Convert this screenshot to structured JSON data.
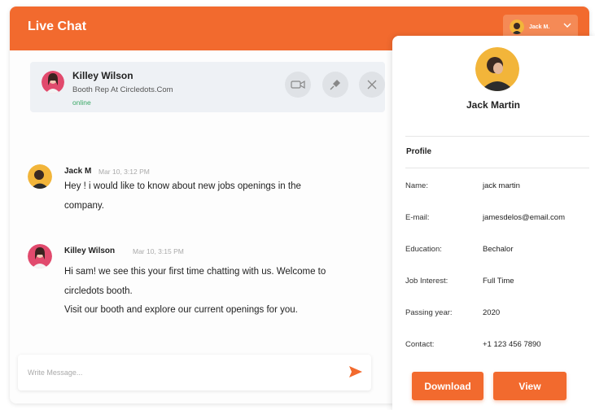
{
  "header": {
    "title": "Live Chat",
    "user_name": "Jack M."
  },
  "contact": {
    "name": "Killey Wilson",
    "role": "Booth Rep At Circledots.Com",
    "status": "online"
  },
  "messages": [
    {
      "sender": "Jack M",
      "time": "Mar 10, 3:12 PM",
      "lines": [
        "Hey ! i would like to  know about new jobs openings in the",
        "company."
      ]
    },
    {
      "sender": "Killey Wilson",
      "time": "Mar 10, 3:15 PM",
      "lines": [
        "Hi sam! we see this your first time chatting with us. Welcome to",
        "circledots booth.",
        "Visit our booth and explore our current openings for you."
      ]
    }
  ],
  "composer": {
    "placeholder": "Write Message..."
  },
  "profile": {
    "name": "Jack Martin",
    "heading": "Profile",
    "fields": [
      {
        "label": "Name:",
        "value": "jack martin"
      },
      {
        "label": "E-mail:",
        "value": "jamesdelos@email.com"
      },
      {
        "label": "Education:",
        "value": "Bechalor"
      },
      {
        "label": "Job Interest:",
        "value": "Full Time"
      },
      {
        "label": "Passing year:",
        "value": "2020"
      },
      {
        "label": "Contact:",
        "value": "+1 123 456 7890"
      }
    ],
    "download_label": "Download",
    "view_label": "View"
  },
  "colors": {
    "accent": "#f26a2e",
    "online": "#3aa866"
  },
  "icons": {
    "video": "video-camera-icon",
    "attach": "pin-icon",
    "close": "close-icon",
    "send": "send-icon",
    "dropdown": "chevron-down-icon"
  }
}
